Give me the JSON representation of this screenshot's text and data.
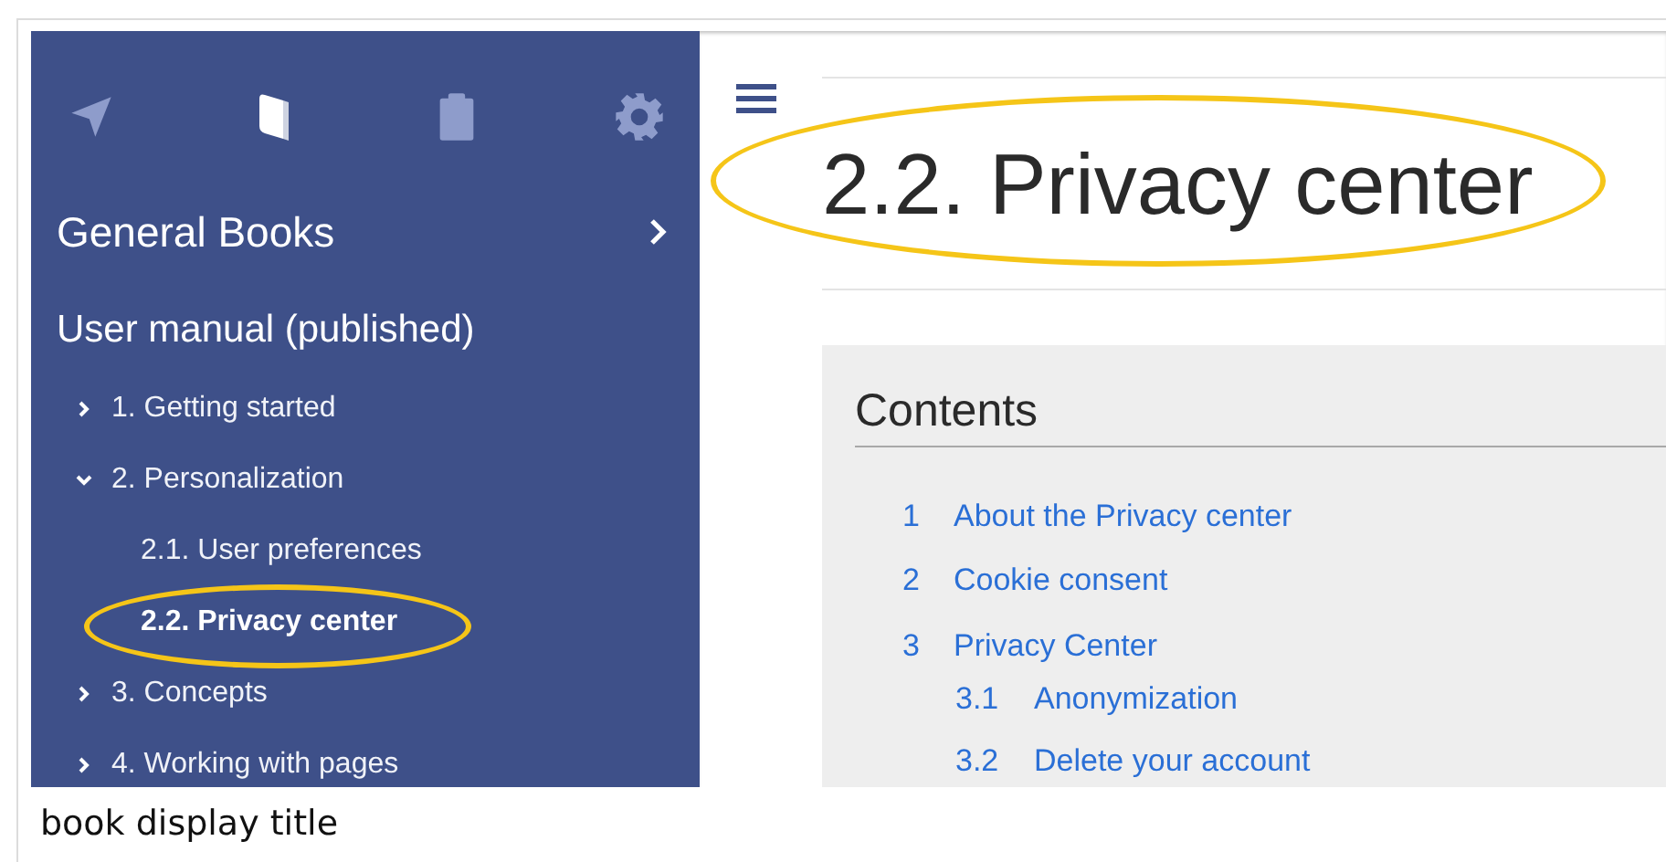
{
  "sidebar": {
    "tabs": [
      {
        "selected": false
      },
      {
        "selected": true
      },
      {
        "selected": false
      },
      {
        "selected": false
      }
    ],
    "book_group": "General Books",
    "book_title": "User manual (published)",
    "tree": [
      {
        "label": "1. Getting started",
        "expanded": false,
        "selected": false
      },
      {
        "label": "2. Personalization",
        "expanded": true,
        "selected": false,
        "children": [
          {
            "label": "2.1. User preferences",
            "selected": false
          },
          {
            "label": "2.2. Privacy center",
            "selected": true,
            "highlighted": true
          }
        ]
      },
      {
        "label": "3. Concepts",
        "expanded": false,
        "selected": false
      },
      {
        "label": "4. Working with pages",
        "expanded": false,
        "selected": false
      }
    ]
  },
  "page": {
    "title": "2.2. Privacy center",
    "title_highlighted": true,
    "toc": {
      "heading": "Contents",
      "items": [
        {
          "number": "1",
          "label": "About the Privacy center"
        },
        {
          "number": "2",
          "label": "Cookie consent"
        },
        {
          "number": "3",
          "label": "Privacy Center",
          "children": [
            {
              "number": "3.1",
              "label": "Anonymization"
            },
            {
              "number": "3.2",
              "label": "Delete your account"
            }
          ]
        }
      ]
    }
  },
  "caption": "book display title"
}
